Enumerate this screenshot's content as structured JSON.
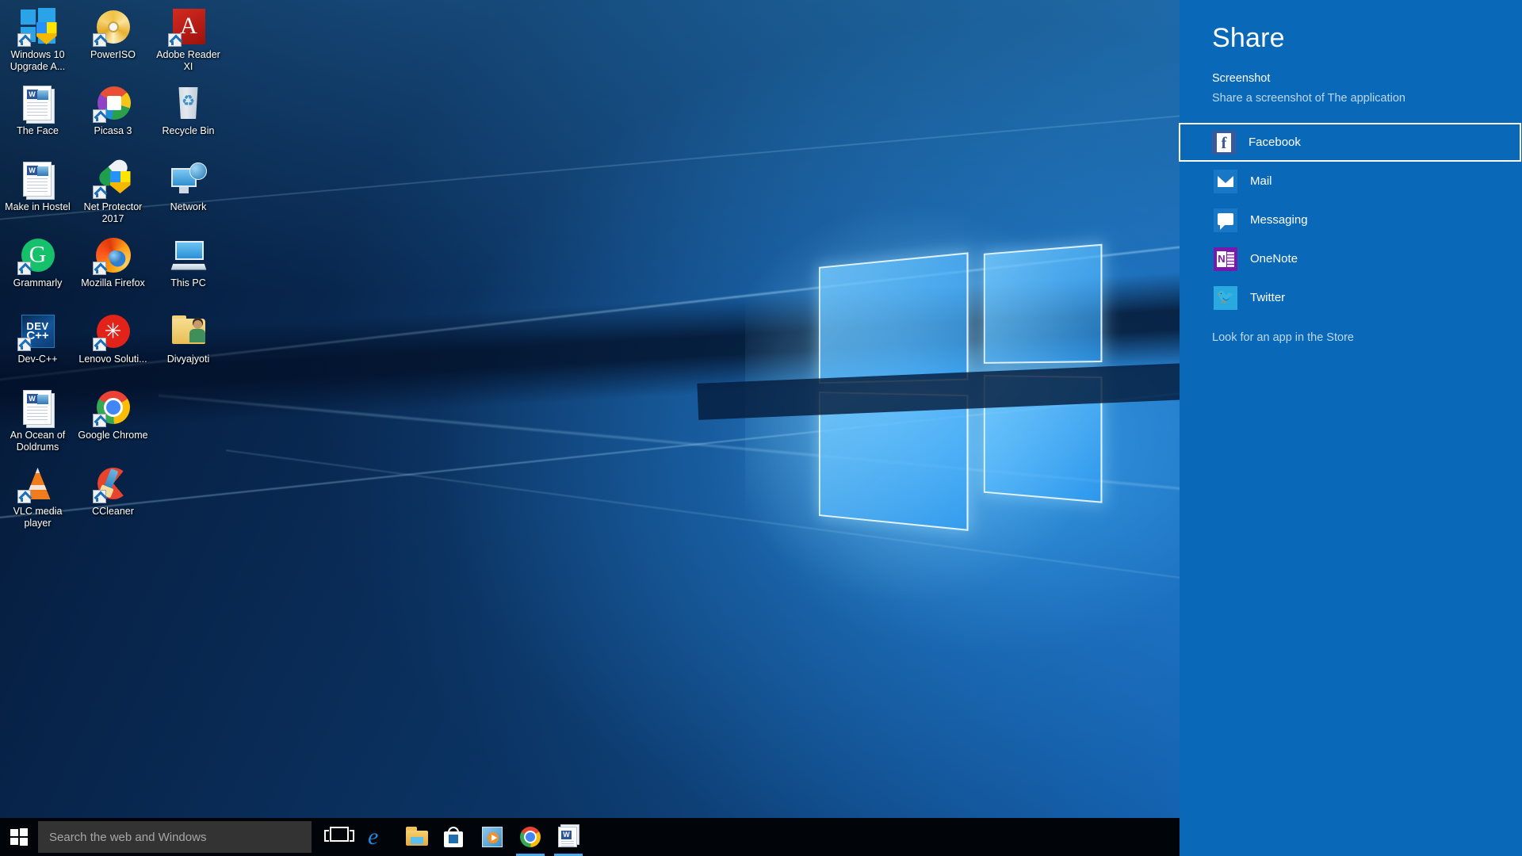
{
  "desktop": {
    "icons": [
      {
        "label": "Windows 10 Upgrade A...",
        "icon": "windows-upgrade-icon",
        "shortcut": true
      },
      {
        "label": "PowerISO",
        "icon": "poweriso-disc-icon",
        "shortcut": true
      },
      {
        "label": "Adobe Reader XI",
        "icon": "adobe-reader-icon",
        "shortcut": true
      },
      {
        "label": "The Face",
        "icon": "word-document-icon",
        "shortcut": false
      },
      {
        "label": "Picasa 3",
        "icon": "picasa-icon",
        "shortcut": true
      },
      {
        "label": "Recycle Bin",
        "icon": "recycle-bin-icon",
        "shortcut": false
      },
      {
        "label": "Make in Hostel",
        "icon": "word-document-icon",
        "shortcut": false
      },
      {
        "label": "Net Protector 2017",
        "icon": "net-protector-icon",
        "shortcut": true
      },
      {
        "label": "Network",
        "icon": "network-icon",
        "shortcut": false
      },
      {
        "label": "Grammarly",
        "icon": "grammarly-icon",
        "shortcut": true
      },
      {
        "label": "Mozilla Firefox",
        "icon": "firefox-icon",
        "shortcut": true
      },
      {
        "label": "This PC",
        "icon": "this-pc-icon",
        "shortcut": false
      },
      {
        "label": "Dev-C++",
        "icon": "dev-cpp-icon",
        "shortcut": true
      },
      {
        "label": "Lenovo Soluti...",
        "icon": "lenovo-solution-icon",
        "shortcut": true
      },
      {
        "label": "Divyajyoti",
        "icon": "user-folder-icon",
        "shortcut": false
      },
      {
        "label": "An Ocean of Doldrums",
        "icon": "word-document-icon",
        "shortcut": false
      },
      {
        "label": "Google Chrome",
        "icon": "chrome-icon",
        "shortcut": true
      },
      {
        "label": "",
        "icon": "blank",
        "shortcut": false
      },
      {
        "label": "VLC media player",
        "icon": "vlc-icon",
        "shortcut": true
      },
      {
        "label": "CCleaner",
        "icon": "ccleaner-icon",
        "shortcut": true
      },
      {
        "label": "",
        "icon": "blank",
        "shortcut": false
      }
    ]
  },
  "taskbar": {
    "start_label": "Start",
    "search_placeholder": "Search the web and Windows",
    "search_value": "",
    "items": [
      {
        "name": "task-view",
        "label": "Task View",
        "active": false
      },
      {
        "name": "edge",
        "label": "Microsoft Edge",
        "active": false
      },
      {
        "name": "file-explorer",
        "label": "File Explorer",
        "active": false
      },
      {
        "name": "store",
        "label": "Store",
        "active": false
      },
      {
        "name": "movies-tv",
        "label": "Movies & TV",
        "active": false
      },
      {
        "name": "chrome",
        "label": "Google Chrome",
        "active": true
      },
      {
        "name": "word",
        "label": "Microsoft Word",
        "active": true
      }
    ]
  },
  "share_panel": {
    "title": "Share",
    "subject": "Screenshot",
    "description": "Share a screenshot of The application",
    "store_link": "Look for an app in the Store",
    "apps": [
      {
        "label": "Facebook",
        "icon": "facebook-icon",
        "selected": true,
        "color": "#3b5998"
      },
      {
        "label": "Mail",
        "icon": "mail-icon",
        "selected": false,
        "color": "#1878c6"
      },
      {
        "label": "Messaging",
        "icon": "messaging-icon",
        "selected": false,
        "color": "#1878c6"
      },
      {
        "label": "OneNote",
        "icon": "onenote-icon",
        "selected": false,
        "color": "#7719aa"
      },
      {
        "label": "Twitter",
        "icon": "twitter-icon",
        "selected": false,
        "color": "#2aa9e0"
      }
    ],
    "background_color": "#0a68b8",
    "accent_color": "#ffffff"
  }
}
